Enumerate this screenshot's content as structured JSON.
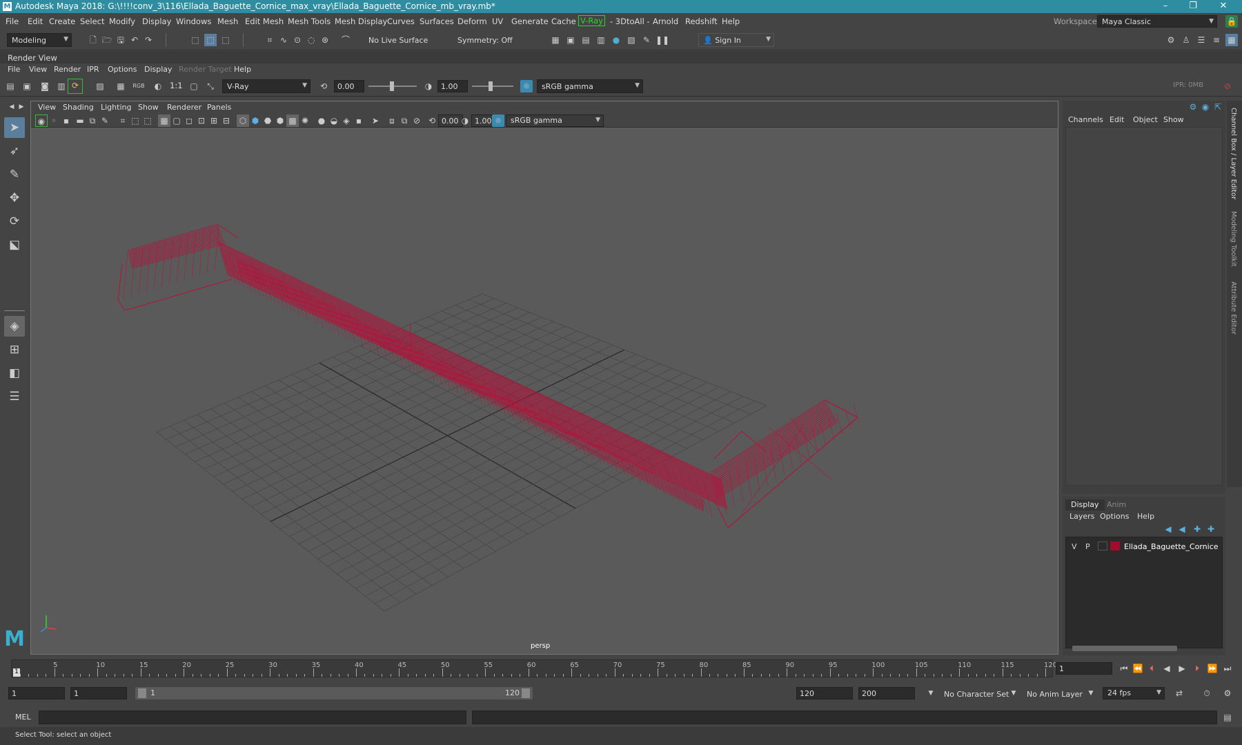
{
  "window": {
    "title": "Autodesk Maya 2018: G:\\!!!!conv_3\\116\\Ellada_Baguette_Cornice_max_vray\\Ellada_Baguette_Cornice_mb_vray.mb*",
    "minimize": "–",
    "restore": "❐",
    "close": "✕"
  },
  "menubar": {
    "items": [
      "File",
      "Edit",
      "Create",
      "Select",
      "Modify",
      "Display",
      "Windows",
      "Mesh",
      "Edit Mesh",
      "Mesh Tools",
      "Mesh Display",
      "Curves",
      "Surfaces",
      "Deform",
      "UV",
      "Generate",
      "Cache",
      "V-Ray",
      "- 3DtoAll -",
      "Arnold",
      "Redshift",
      "Help"
    ],
    "workspace_label": "Workspace :",
    "workspace_value": "Maya Classic"
  },
  "toolbar": {
    "mode": "Modeling",
    "live_surface": "No Live Surface",
    "symmetry": "Symmetry: Off",
    "sign_in": "Sign In"
  },
  "render_view": {
    "label": "Render View",
    "menu": [
      "File",
      "View",
      "Render",
      "IPR",
      "Options",
      "Display",
      "Render Target",
      "Help"
    ],
    "ratio": "1:1",
    "renderer": "V-Ray",
    "exposure": "0.00",
    "gamma": "1.00",
    "color_space": "sRGB gamma",
    "ipr": "IPR: 0MB",
    "rgb": "RGB"
  },
  "viewport": {
    "menu": [
      "View",
      "Shading",
      "Lighting",
      "Show",
      "Renderer",
      "Panels"
    ],
    "exposure": "0.00",
    "gamma": "1.00",
    "color_space": "sRGB gamma",
    "camera": "persp",
    "mesh_color": "#b5123a"
  },
  "channel_box": {
    "menu": [
      "Channels",
      "Edit",
      "Object",
      "Show"
    ],
    "side_tabs": [
      "Channel Box / Layer Editor",
      "Modeling Toolkit",
      "Attribute Editor"
    ]
  },
  "layer_editor": {
    "tabs": [
      "Display",
      "Anim"
    ],
    "menu": [
      "Layers",
      "Options",
      "Help"
    ],
    "layers": [
      {
        "v": "V",
        "p": "P",
        "color": "#9a0f2c",
        "name": "Ellada_Baguette_Cornice"
      }
    ]
  },
  "timeline": {
    "ticks": [
      "5",
      "10",
      "15",
      "20",
      "25",
      "30",
      "35",
      "40",
      "45",
      "50",
      "55",
      "60",
      "65",
      "70",
      "75",
      "80",
      "85",
      "90",
      "95",
      "100",
      "105",
      "110",
      "115",
      "120"
    ],
    "start_marker": "1",
    "current_frame": "1"
  },
  "range": {
    "start": "1",
    "playback_start": "1",
    "slider_start": "1",
    "slider_end": "120",
    "playback_end": "120",
    "end": "200",
    "character_set": "No Character Set",
    "anim_layer": "No Anim Layer",
    "fps": "24 fps"
  },
  "command_line": {
    "label": "MEL"
  },
  "status": {
    "help": "Select Tool: select an object"
  }
}
